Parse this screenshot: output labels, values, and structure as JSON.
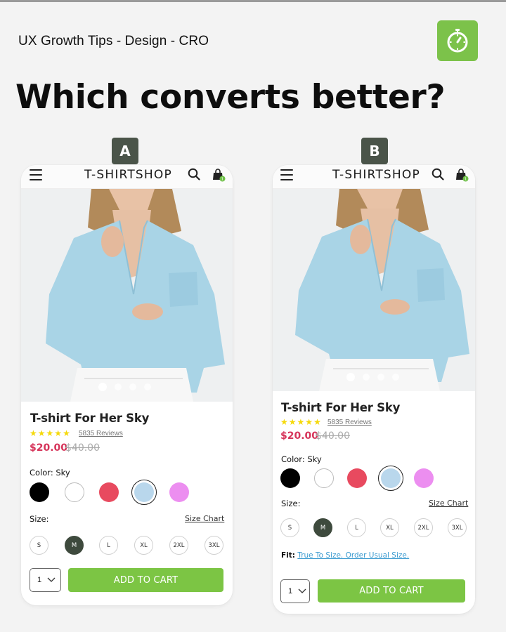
{
  "header": {
    "brand_line": "UX Growth Tips - Design - CRO",
    "logo_icon": "stopwatch-icon",
    "logo_color": "#7cc24a",
    "headline": "Which converts better?"
  },
  "variants": [
    {
      "badge": "A",
      "shop_title": "T-SHIRTSHOP",
      "cart_count": "1",
      "icons": [
        "menu-icon",
        "search-icon",
        "shopping-bag-icon"
      ],
      "carousel": {
        "dots": 4,
        "active": 0
      },
      "product": {
        "title": "T-shirt For Her Sky",
        "rating": 5,
        "reviews": "5835 Reviews",
        "price": "$20.00",
        "old_price": "$40.00",
        "color_label": "Color: Sky",
        "colors": [
          {
            "name": "Black",
            "hex": "#000000",
            "selected": false
          },
          {
            "name": "White",
            "hex": "#ffffff",
            "selected": false
          },
          {
            "name": "Red",
            "hex": "#e84a5f",
            "selected": false
          },
          {
            "name": "Sky",
            "hex": "#b9d7ec",
            "selected": true
          },
          {
            "name": "Pink",
            "hex": "#ec8ef0",
            "selected": false
          }
        ],
        "size_label": "Size:",
        "size_chart": "Size Chart",
        "sizes": [
          {
            "label": "S",
            "selected": false
          },
          {
            "label": "M",
            "selected": true
          },
          {
            "label": "L",
            "selected": false
          },
          {
            "label": "XL",
            "selected": false
          },
          {
            "label": "2XL",
            "selected": false
          },
          {
            "label": "3XL",
            "selected": false
          }
        ],
        "quantity": "1",
        "add_to_cart": "ADD TO CART"
      }
    },
    {
      "badge": "B",
      "shop_title": "T-SHIRTSHOP",
      "cart_count": "1",
      "icons": [
        "menu-icon",
        "search-icon",
        "shopping-bag-icon"
      ],
      "carousel": {
        "dots": 4,
        "active": 0
      },
      "product": {
        "title": "T-shirt For Her Sky",
        "rating": 5,
        "reviews": "5835 Reviews",
        "price": "$20.00",
        "old_price": "$40.00",
        "color_label": "Color: Sky",
        "colors": [
          {
            "name": "Black",
            "hex": "#000000",
            "selected": false
          },
          {
            "name": "White",
            "hex": "#ffffff",
            "selected": false
          },
          {
            "name": "Red",
            "hex": "#e84a5f",
            "selected": false
          },
          {
            "name": "Sky",
            "hex": "#b9d7ec",
            "selected": true
          },
          {
            "name": "Pink",
            "hex": "#ec8ef0",
            "selected": false
          }
        ],
        "size_label": "Size:",
        "size_chart": "Size Chart",
        "sizes": [
          {
            "label": "S",
            "selected": false
          },
          {
            "label": "M",
            "selected": true
          },
          {
            "label": "L",
            "selected": false
          },
          {
            "label": "XL",
            "selected": false
          },
          {
            "label": "2XL",
            "selected": false
          },
          {
            "label": "3XL",
            "selected": false
          }
        ],
        "fit_label": "Fit:",
        "fit_text": "True To Size. Order Usual Size.",
        "quantity": "1",
        "add_to_cart": "ADD TO CART"
      }
    }
  ]
}
